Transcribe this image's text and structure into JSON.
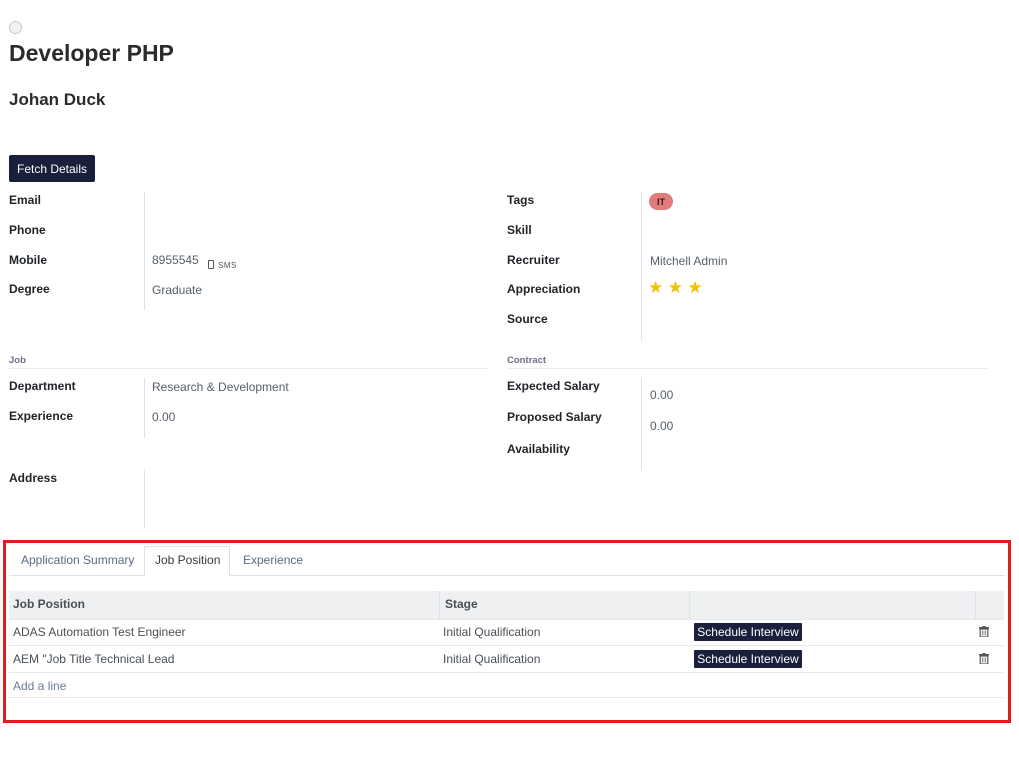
{
  "record": {
    "title": "Developer PHP",
    "name": "Johan Duck"
  },
  "actions": {
    "fetch_label": "Fetch Details"
  },
  "left_fields": {
    "email_label": "Email",
    "phone_label": "Phone",
    "mobile_label": "Mobile",
    "mobile_value": "8955545",
    "sms_label": "SMS",
    "degree_label": "Degree",
    "degree_value": "Graduate"
  },
  "right_fields": {
    "tags_label": "Tags",
    "tag_value": "IT",
    "tag_color": "#e07c7c",
    "skill_label": "Skill",
    "recruiter_label": "Recruiter",
    "recruiter_value": "Mitchell Admin",
    "appreciation_label": "Appreciation",
    "appreciation_stars": 3,
    "source_label": "Source"
  },
  "job_section": {
    "title": "Job",
    "department_label": "Department",
    "department_value": "Research & Development",
    "experience_label": "Experience",
    "experience_value": "0.00"
  },
  "contract_section": {
    "title": "Contract",
    "expected_salary_label": "Expected Salary",
    "expected_salary_value": "0.00",
    "proposed_salary_label": "Proposed Salary",
    "proposed_salary_value": "0.00",
    "availability_label": "Availability"
  },
  "address": {
    "label": "Address"
  },
  "tabs": [
    {
      "label": "Application Summary",
      "active": false
    },
    {
      "label": "Job Position",
      "active": true
    },
    {
      "label": "Experience",
      "active": false
    }
  ],
  "table": {
    "columns": [
      "Job Position",
      "Stage"
    ],
    "rows": [
      {
        "job_position": "ADAS Automation Test Engineer",
        "stage": "Initial Qualification",
        "action": "Schedule Interview"
      },
      {
        "job_position": "AEM \"Job Title Technical Lead",
        "stage": "Initial Qualification",
        "action": "Schedule Interview"
      }
    ],
    "add_line": "Add a line"
  },
  "colors": {
    "primary": "#1a1f3b",
    "highlight_frame": "#e01b1b",
    "star": "#f3c200"
  }
}
